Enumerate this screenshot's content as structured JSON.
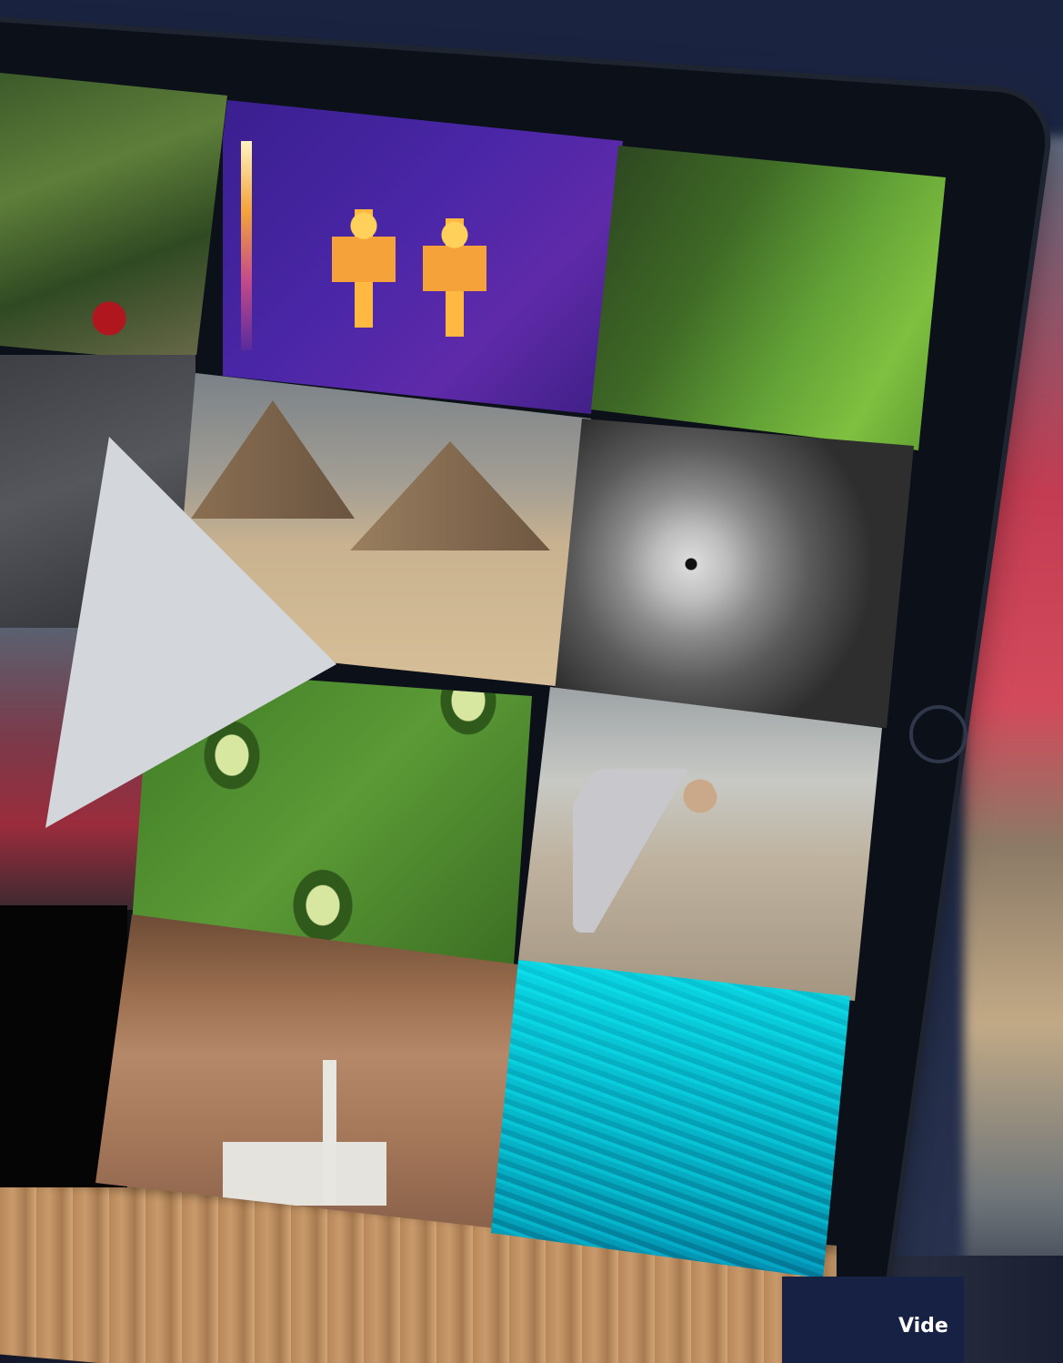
{
  "caption": {
    "label": "Vide"
  },
  "colors": {
    "background": "#1b2540",
    "caption_panel": "#172144",
    "caption_text": "#ffffff",
    "play_icon": "#d3d7dc"
  },
  "icons": {
    "play": "play-icon",
    "home_button": "home-button-icon"
  }
}
